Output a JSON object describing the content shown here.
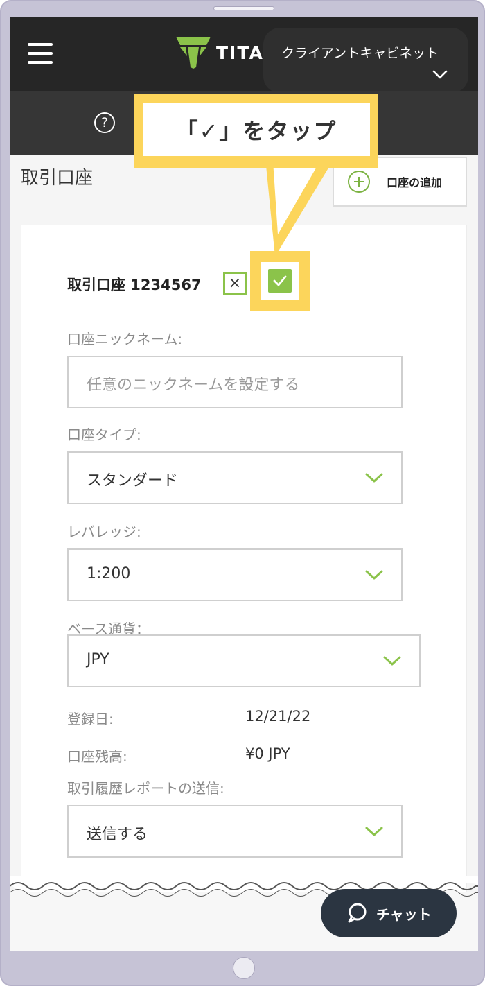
{
  "header": {
    "logo_text": "TITA",
    "cabinet_label": "クライアントキャビネット"
  },
  "subbar": {
    "help_glyph": "?"
  },
  "page": {
    "title": "取引口座",
    "add_account_label": "口座の追加"
  },
  "account": {
    "heading": "取引口座 1234567",
    "cancel_glyph": "×",
    "save_state": "checked"
  },
  "callout": {
    "text": "「✓」をタップ"
  },
  "form": {
    "nickname_label": "口座ニックネーム:",
    "nickname_placeholder": "任意のニックネームを設定する",
    "nickname_value": "",
    "account_type_label": "口座タイプ:",
    "account_type_value": "スタンダード",
    "leverage_label": "レバレッジ:",
    "leverage_value": "1:200",
    "base_currency_label": "ベース通貨：",
    "base_currency_value": "JPY",
    "registered_label": "登録日:",
    "registered_value": "12/21/22",
    "balance_label": "口座残高:",
    "balance_value": "¥0 JPY",
    "report_label": "取引履歴レポートの送信:",
    "report_value": "送信する"
  },
  "chat": {
    "label": "チャット"
  },
  "colors": {
    "accent": "#8bc34a",
    "callout": "#fcd55b",
    "topbar": "#262626",
    "chat": "#2b3541"
  }
}
